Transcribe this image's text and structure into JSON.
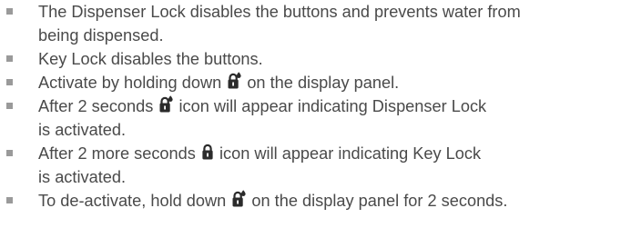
{
  "bullets": [
    {
      "lines": [
        {
          "text": "The Dispenser Lock disables the buttons and prevents water from"
        },
        {
          "text": "being dispensed."
        }
      ]
    },
    {
      "lines": [
        {
          "text": "Key Lock disables the buttons."
        }
      ]
    },
    {
      "lines": [
        {
          "before": "Activate by holding down ",
          "icon": "dispenser-lock-icon",
          "after": " on the display panel."
        }
      ]
    },
    {
      "lines": [
        {
          "before": "After 2 seconds ",
          "icon": "dispenser-lock-icon",
          "after": " icon will appear indicating Dispenser Lock"
        },
        {
          "text": "is activated."
        }
      ]
    },
    {
      "lines": [
        {
          "before": "After 2 more seconds ",
          "icon": "key-lock-icon",
          "after": " icon will appear indicating Key Lock"
        },
        {
          "text": "is activated."
        }
      ]
    },
    {
      "lines": [
        {
          "before": "To de-activate, hold down ",
          "icon": "dispenser-lock-icon",
          "after": " on the display panel for 2 seconds."
        }
      ]
    }
  ],
  "colors": {
    "text": "#4a4a4a",
    "bullet": "#9a9a9a",
    "icon": "#2b2b2b"
  }
}
